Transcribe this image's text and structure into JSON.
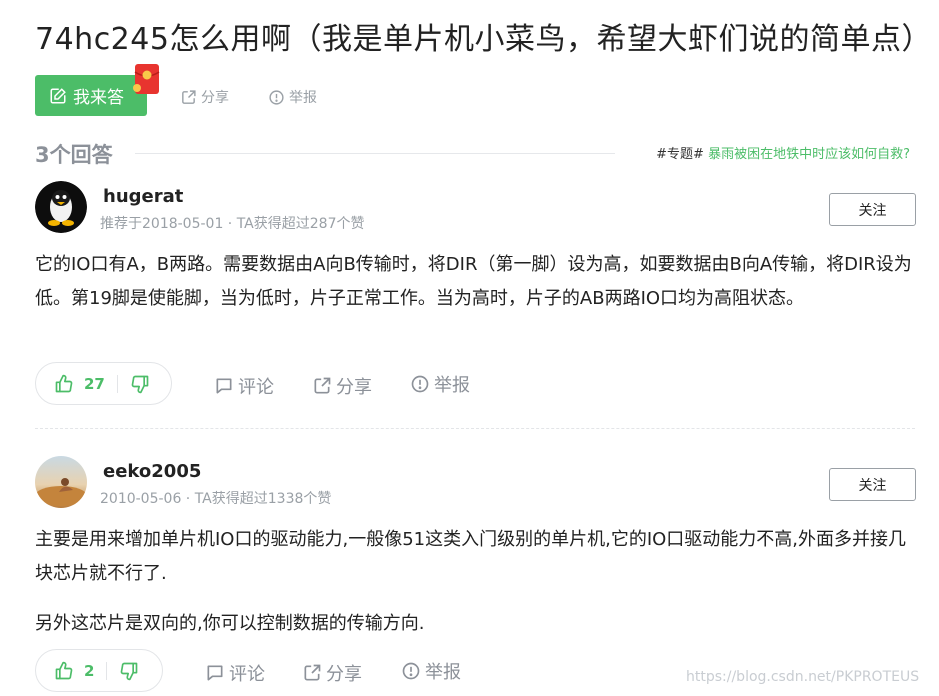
{
  "question": {
    "title": "74hc245怎么用啊（我是单片机小菜鸟，希望大虾们说的简单点）",
    "answer_button_label": "我来答",
    "share_label": "分享",
    "report_label": "举报"
  },
  "answers_header": {
    "count_label": "3个回答",
    "topic_prefix": "#专题#",
    "topic_link": "暴雨被困在地铁中时应该如何自救?"
  },
  "answers": [
    {
      "username": "hugerat",
      "meta": "推荐于2018-05-01 · TA获得超过287个赞",
      "follow_label": "关注",
      "paragraphs": [
        "它的IO口有A，B两路。需要数据由A向B传输时，将DIR（第一脚）设为高，如要数据由B向A传输，将DIR设为低。第19脚是使能脚，当为低时，片子正常工作。当为高时，片子的AB两路IO口均为高阻状态。"
      ],
      "upvotes": "27",
      "comment_label": "评论",
      "share_label": "分享",
      "report_label": "举报"
    },
    {
      "username": "eeko2005",
      "meta": "2010-05-06 · TA获得超过1338个赞",
      "follow_label": "关注",
      "paragraphs": [
        "主要是用来增加单片机IO口的驱动能力,一般像51这类入门级别的单片机,它的IO口驱动能力不高,外面多并接几块芯片就不行了.",
        "另外这芯片是双向的,你可以控制数据的传输方向."
      ],
      "upvotes": "2",
      "comment_label": "评论",
      "share_label": "分享",
      "report_label": "举报"
    }
  ],
  "watermark": "https://blog.csdn.net/PKPROTEUS",
  "colors": {
    "accent_green": "#4cbd68",
    "muted_gray": "#9aa0a6",
    "redpacket": "#e8342f"
  },
  "icons": [
    "edit-icon",
    "red-packet-icon",
    "share-icon",
    "report-icon",
    "thumbs-up-icon",
    "thumbs-down-icon",
    "comment-icon"
  ]
}
